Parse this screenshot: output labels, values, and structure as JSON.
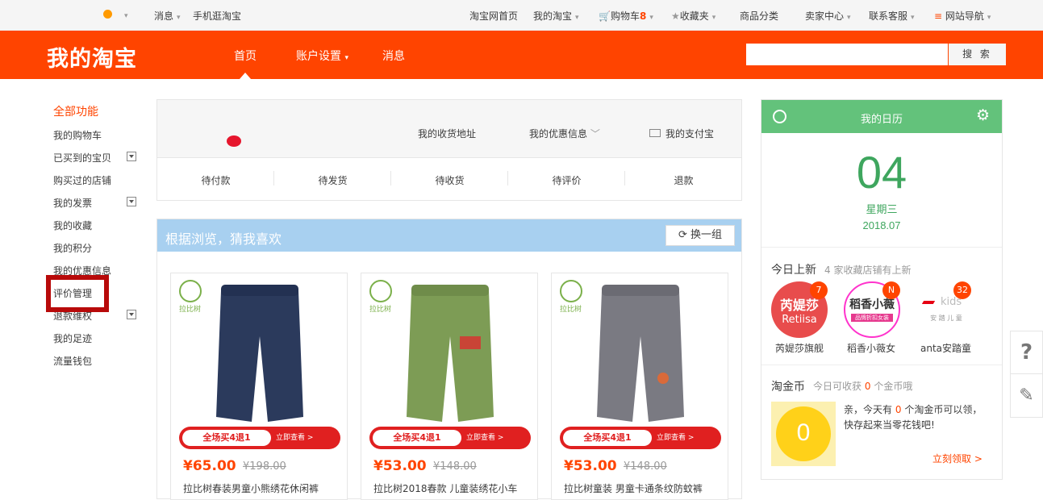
{
  "topbar": {
    "messages": "消息",
    "mobile": "手机逛淘宝",
    "home": "淘宝网首页",
    "my_taobao": "我的淘宝",
    "cart_label": "购物车",
    "cart_count": "8",
    "favorites": "收藏夹",
    "categories": "商品分类",
    "seller": "卖家中心",
    "service": "联系客服",
    "site_nav": "网站导航"
  },
  "header": {
    "logo": "我的淘宝",
    "nav": [
      "首页",
      "账户设置",
      "消息"
    ],
    "search_button": "搜 索",
    "search_value": ""
  },
  "sidebar": {
    "title": "全部功能",
    "items": [
      "我的购物车",
      "已买到的宝贝",
      "购买过的店铺",
      "我的发票",
      "我的收藏",
      "我的积分",
      "我的优惠信息",
      "评价管理",
      "退款维权",
      "我的足迹",
      "流量钱包"
    ]
  },
  "profile": {
    "address": "我的收货地址",
    "coupons": "我的优惠信息",
    "payment": "我的支付宝",
    "orders": [
      "待付款",
      "待发货",
      "待收货",
      "待评价",
      "退款"
    ]
  },
  "recommend": {
    "title": "根据浏览，猜我喜欢",
    "refresh": "换一组",
    "products": [
      {
        "brand": "拉比树",
        "banner": "全场买4退1",
        "banner_sub": "立即查看 >",
        "price": "¥65.00",
        "old_price": "¥198.00",
        "name": "拉比树春装男童小熊绣花休闲裤",
        "color": "#2b3a5c"
      },
      {
        "brand": "拉比树",
        "banner": "全场买4退1",
        "banner_sub": "立即查看 >",
        "price": "¥53.00",
        "old_price": "¥148.00",
        "name": "拉比树2018春款 儿童装绣花小车",
        "color": "#7d9c55"
      },
      {
        "brand": "拉比树",
        "banner": "全场买4退1",
        "banner_sub": "立即查看 >",
        "price": "¥53.00",
        "old_price": "¥148.00",
        "name": "拉比树童装 男童卡通条纹防蚊裤",
        "color": "#7a7a82"
      }
    ]
  },
  "calendar": {
    "title": "我的日历",
    "day": "04",
    "weekday": "星期三",
    "year_month": "2018.07",
    "new_today_title": "今日上新",
    "new_today_sub": "4 家收藏店铺有上新",
    "shops": [
      {
        "name": "芮媞莎旗舰",
        "badge": "7",
        "logo_text": "芮媞莎",
        "logo_sub": "Retiisa",
        "color": "#e84c4c"
      },
      {
        "name": "稻香小薇女",
        "badge": "N",
        "logo_text": "稻香小薇",
        "logo_sub": "品牌折扣女装",
        "color": "#ffffff"
      },
      {
        "name": "anta安踏童",
        "badge": "32",
        "logo_text": "kids",
        "logo_sub": "安 踏 儿 童",
        "color": "#ffffff"
      }
    ],
    "coin_title": "淘金币",
    "coin_sub_prefix": "今日可收获",
    "coin_sub_value": "0",
    "coin_sub_suffix": "个金币哦",
    "coin_count": "0",
    "coin_msg_1": "亲，今天有",
    "coin_msg_value": "0",
    "coin_msg_2": "个淘金币可以领，快存起来当零花钱吧!",
    "coin_claim": "立刻领取 >"
  },
  "colors": {
    "brand": "#ff4400",
    "calendar": "#63c27b",
    "recommend": "#a8d0f0",
    "highlight": "#b80a0a"
  }
}
